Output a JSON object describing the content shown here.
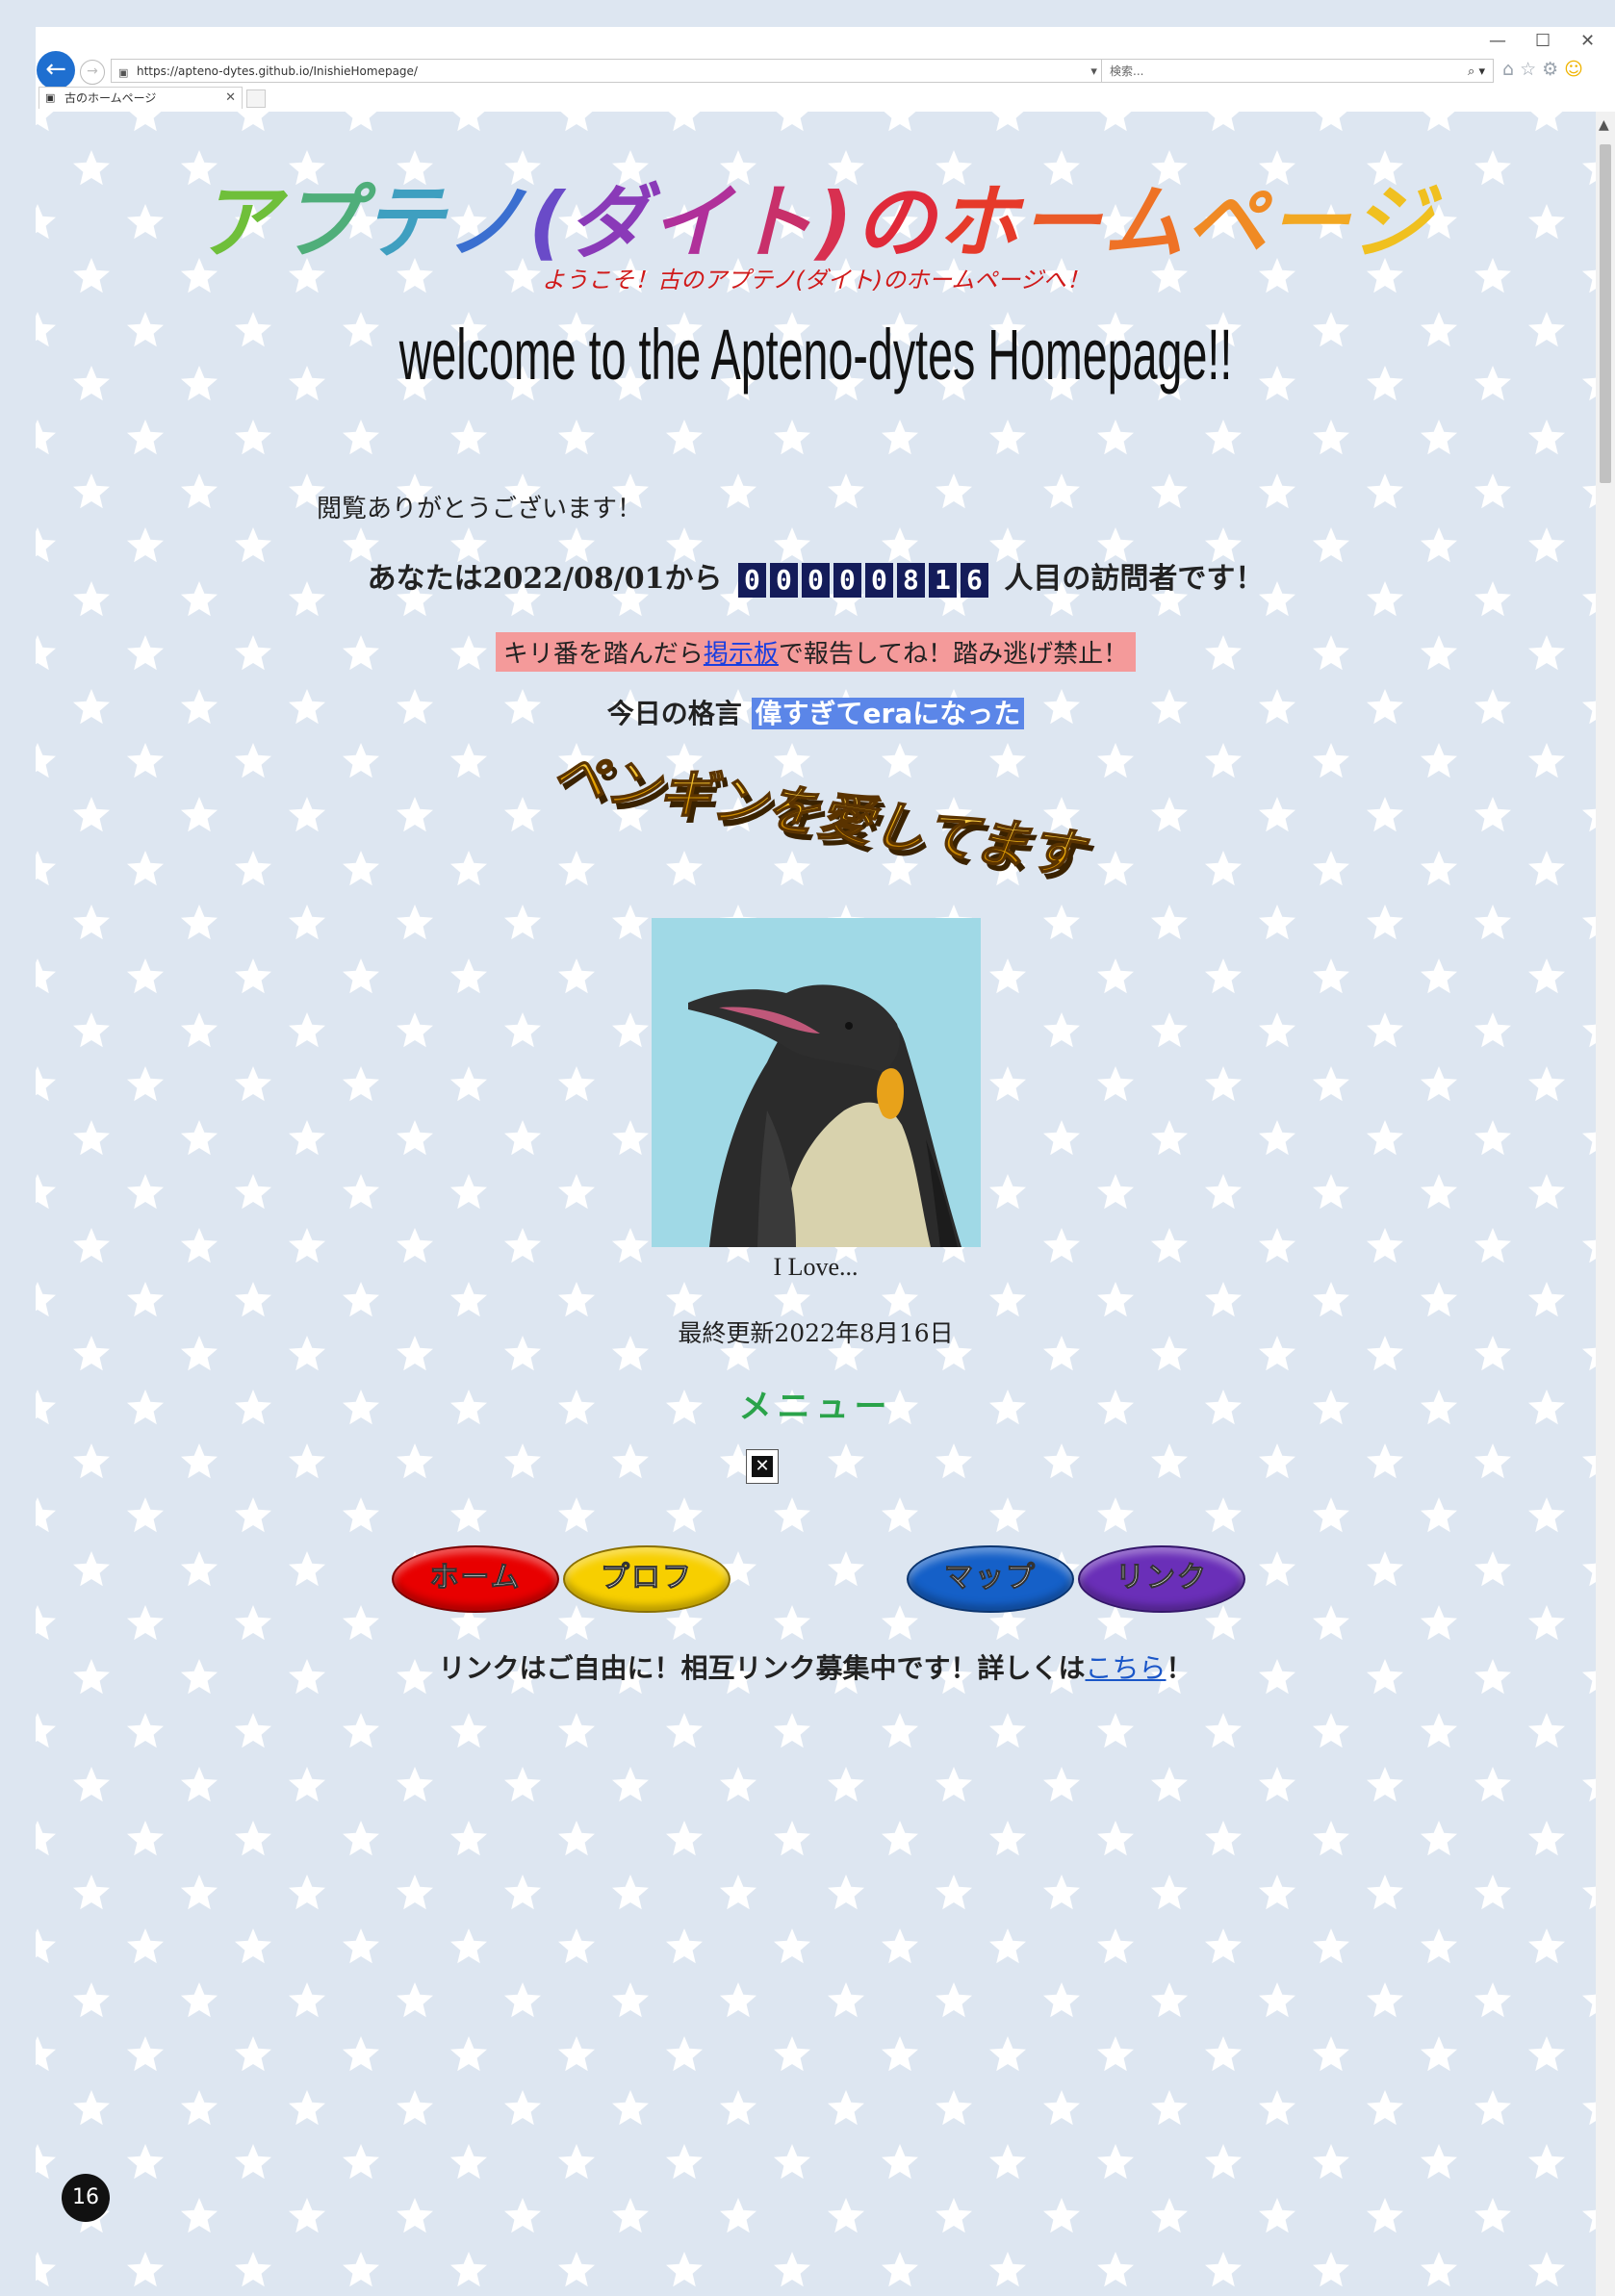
{
  "browser": {
    "url": "https://apteno-dytes.github.io/InishieHomepage/",
    "search_placeholder": "検索...",
    "tab_title": "古のホームページ",
    "window_controls": [
      "—",
      "☐",
      "✕"
    ]
  },
  "page": {
    "title_chars": [
      {
        "ch": "ア",
        "color": "#6fbf3a"
      },
      {
        "ch": "プ",
        "color": "#4fae7a"
      },
      {
        "ch": "テ",
        "color": "#3f9fc0"
      },
      {
        "ch": "ノ",
        "color": "#3a6fd0"
      },
      {
        "ch": "(",
        "color": "#6a4bc8"
      },
      {
        "ch": "ダ",
        "color": "#8a3ab8"
      },
      {
        "ch": "イ",
        "color": "#b0309a"
      },
      {
        "ch": "ト",
        "color": "#c8306a"
      },
      {
        "ch": ")",
        "color": "#d83050"
      },
      {
        "ch": "の",
        "color": "#e02a3a"
      },
      {
        "ch": "ホ",
        "color": "#e63a2a"
      },
      {
        "ch": "ー",
        "color": "#ea5a28"
      },
      {
        "ch": "ム",
        "color": "#ee7226"
      },
      {
        "ch": "ペ",
        "color": "#f08a24"
      },
      {
        "ch": "ー",
        "color": "#f2a822"
      },
      {
        "ch": "ジ",
        "color": "#f0c020"
      }
    ],
    "subtitle": "ようこそ！古のアプテノ(ダイト)のホームページへ！",
    "welcome": "welcome to the Apteno-dytes Homepage!!",
    "thanks": "閲覧ありがとうございます！",
    "visitor_prefix": "あなたは2022/08/01から",
    "visitor_count": "00000816",
    "visitor_suffix": "人目の訪問者です！",
    "kiriban_before": "キリ番を踏んだら",
    "kiriban_link": "掲示板",
    "kiriban_after": "で報告してね！踏み逃げ禁止！",
    "quote_label": "今日の格言",
    "quote_text": "偉すぎてeraになった",
    "love_banner": "ペンギンを愛してます",
    "penguin_caption": "I Love...",
    "updated": "最終更新2022年8月16日",
    "menu_title": "メニュー",
    "menu_buttons": [
      {
        "label": "ホーム",
        "color": "#e80000"
      },
      {
        "label": "プロフ",
        "color": "#f7cf00"
      },
      {
        "label": "マップ",
        "color": "#1560c8"
      },
      {
        "label": "リンク",
        "color": "#6a2fb8"
      }
    ],
    "link_note_before": "リンクはご自由に！相互リンク募集中です！詳しくは",
    "link_note_link": "こちら",
    "link_note_after": "！"
  },
  "slide_number": "16"
}
